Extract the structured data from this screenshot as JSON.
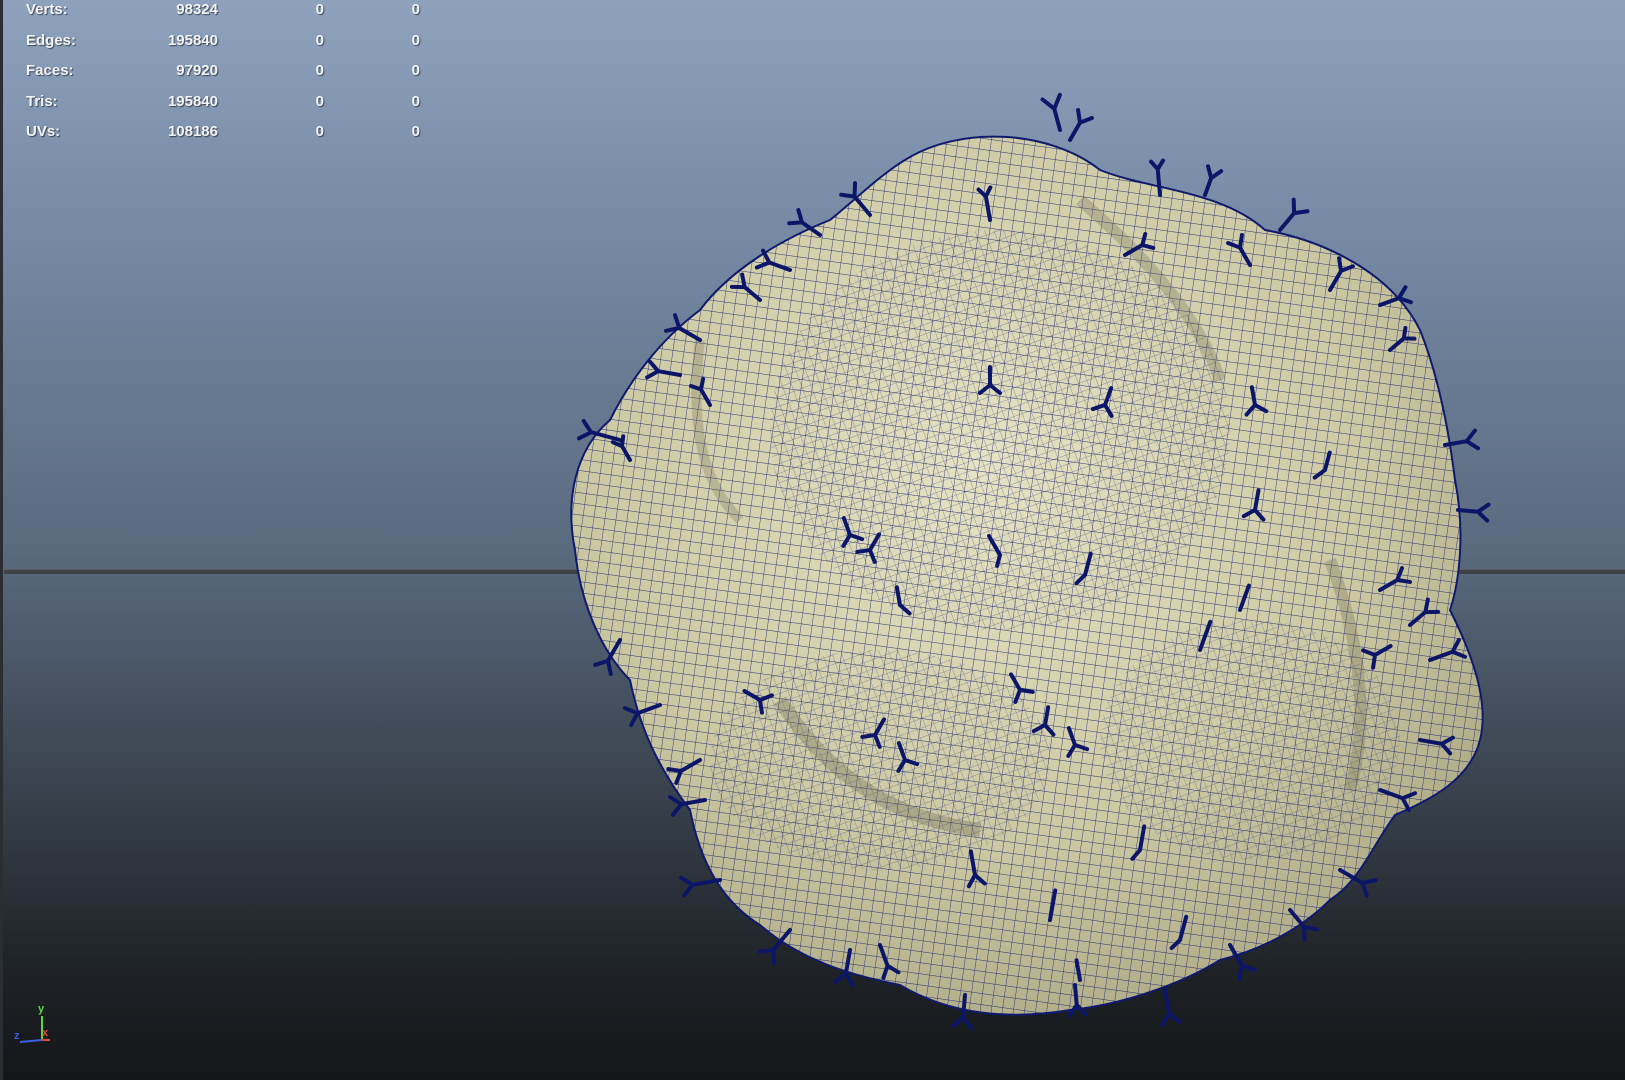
{
  "stats": {
    "rows": [
      {
        "label": "Verts:",
        "v1": "98324",
        "v2": "0",
        "v3": "0"
      },
      {
        "label": "Edges:",
        "v1": "195840",
        "v2": "0",
        "v3": "0"
      },
      {
        "label": "Faces:",
        "v1": "97920",
        "v2": "0",
        "v3": "0"
      },
      {
        "label": "Tris:",
        "v1": "195840",
        "v2": "0",
        "v3": "0"
      },
      {
        "label": "UVs:",
        "v1": "108186",
        "v2": "0",
        "v3": "0"
      }
    ]
  },
  "axis": {
    "y": "y",
    "x": "x",
    "z": "z"
  },
  "colors": {
    "mesh_fill": "#d6d3ad",
    "wire": "#0f1a6e",
    "spike": "#0c1668",
    "background_top": "#8ea2bd",
    "background_bottom": "#141618"
  }
}
